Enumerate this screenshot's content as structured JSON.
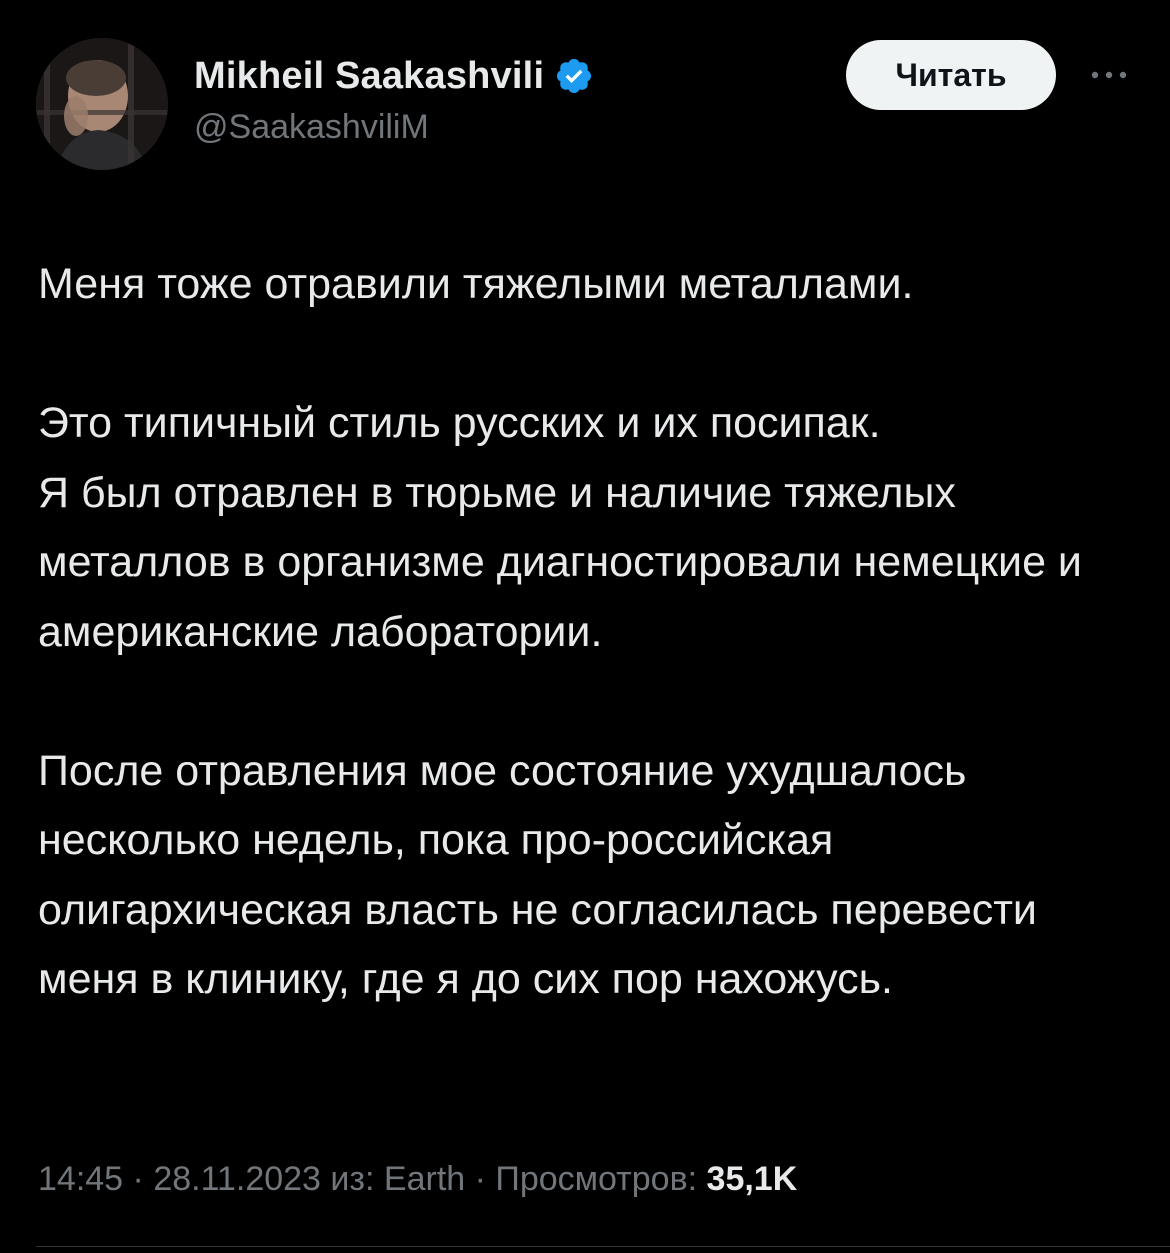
{
  "author": {
    "display_name": "Mikheil Saakashvili",
    "handle": "@SaakashviliM",
    "verified": true,
    "verified_color": "#1d9bf0"
  },
  "header": {
    "read_button_label": "Читать",
    "more_icon": "ellipsis-icon"
  },
  "tweet": {
    "paragraph_1": "Меня тоже отравили тяжелыми металлами.",
    "paragraph_2": "Это типичный стиль русских и их посипак.\nЯ был отравлен в тюрьме и наличие тяжелых металлов в организме диагностировали немецкие и американские лаборатории.",
    "paragraph_3": "После отравления мое состояние ухудшалось несколько недель, пока про-российская олигархическая власть не согласилась перевести меня в клинику, где я до сих пор нахожусь."
  },
  "meta": {
    "time": "14:45",
    "separator": " · ",
    "date": "28.11.2023",
    "source_prefix": "из: ",
    "source": "Earth",
    "views_label": "Просмотров: ",
    "views_count": "35,1K"
  },
  "colors": {
    "background": "#000000",
    "primary_text": "#e7e9ea",
    "secondary_text": "#71767b",
    "button_bg": "#eff3f4",
    "button_text": "#0f1419"
  }
}
